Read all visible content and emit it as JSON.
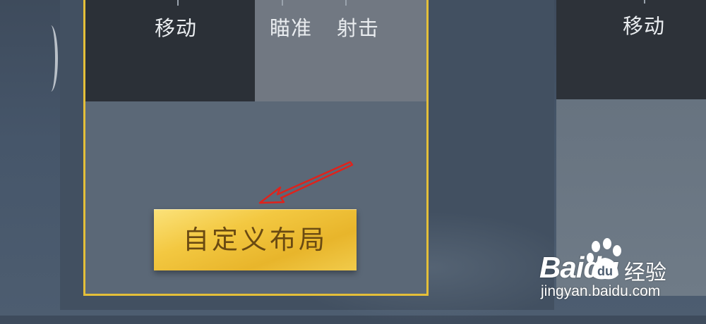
{
  "layout_cards": [
    {
      "zones": [
        {
          "label": "移动"
        },
        {
          "label": "瞄准"
        },
        {
          "label": "射击"
        }
      ],
      "selected": true,
      "action_button": {
        "label": "自定义布局"
      }
    },
    {
      "zones": [
        {
          "label": "移动"
        }
      ],
      "selected": false
    }
  ],
  "colors": {
    "selected_border": "#e4bf39",
    "button_gold": "#f3c841",
    "annotation_arrow": "#e0221b"
  },
  "icons": {
    "back": "left-bracket-icon",
    "annotation": "red-arrow-icon",
    "watermark_logo": "baidu-paw-icon"
  },
  "watermark": {
    "brand": "Baidu",
    "product": "经验",
    "url": "jingyan.baidu.com"
  }
}
